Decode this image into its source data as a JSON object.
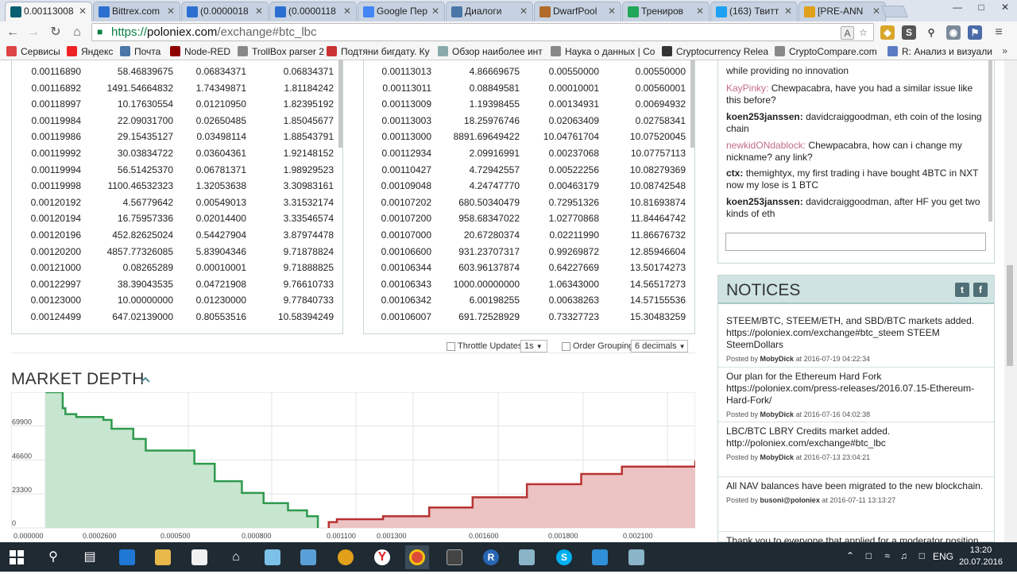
{
  "browser": {
    "tabs": [
      {
        "label": "0.00113008",
        "icon": "poloniex-icon",
        "color": "#0b5f73"
      },
      {
        "label": "Bittrex.com",
        "icon": "bittrex-icon",
        "color": "#2c6fd1"
      },
      {
        "label": "(0.0000018",
        "icon": "bittrex-icon",
        "color": "#2c6fd1"
      },
      {
        "label": "(0.0000118",
        "icon": "bittrex-icon",
        "color": "#2c6fd1"
      },
      {
        "label": "Google Пер",
        "icon": "google-translate-icon",
        "color": "#4285f4"
      },
      {
        "label": "Диалоги",
        "icon": "vk-icon",
        "color": "#4a76a8"
      },
      {
        "label": "DwarfPool",
        "icon": "dwarfpool-icon",
        "color": "#b36b2b"
      },
      {
        "label": "Трениров",
        "icon": "tradingview-icon",
        "color": "#22a65a"
      },
      {
        "label": "(163) Твитт",
        "icon": "twitter-icon",
        "color": "#1da1f2"
      },
      {
        "label": "[PRE-ANN",
        "icon": "bitcointalk-icon",
        "color": "#e0a019"
      }
    ],
    "url": {
      "scheme": "https://",
      "domain": "poloniex.com",
      "path": "/exchange#btc_lbc"
    },
    "bookmarks": [
      {
        "label": "Сервисы",
        "color": "#d44"
      },
      {
        "label": "Яндекс",
        "color": "#e22"
      },
      {
        "label": "Почта",
        "color": "#4a76a8"
      },
      {
        "label": "Node-RED",
        "color": "#8f0000"
      },
      {
        "label": "TrollBox parser 2",
        "color": "#888"
      },
      {
        "label": "Подтяни бигдату. Ку",
        "color": "#c33"
      },
      {
        "label": "Обзор наиболее инт",
        "color": "#8aa"
      },
      {
        "label": "Наука о данных | Co",
        "color": "#888"
      },
      {
        "label": "Cryptocurrency Relea",
        "color": "#333"
      },
      {
        "label": "CryptoCompare.com",
        "color": "#888"
      },
      {
        "label": "R: Анализ и визуали",
        "color": "#5b7cc4"
      }
    ]
  },
  "orderbook": {
    "sell_rows": [
      [
        "0.00116890",
        "58.46839675",
        "0.06834371",
        "0.06834371"
      ],
      [
        "0.00116892",
        "1491.54664832",
        "1.74349871",
        "1.81184242"
      ],
      [
        "0.00118997",
        "10.17630554",
        "0.01210950",
        "1.82395192"
      ],
      [
        "0.00119984",
        "22.09031700",
        "0.02650485",
        "1.85045677"
      ],
      [
        "0.00119986",
        "29.15435127",
        "0.03498114",
        "1.88543791"
      ],
      [
        "0.00119992",
        "30.03834722",
        "0.03604361",
        "1.92148152"
      ],
      [
        "0.00119994",
        "56.51425370",
        "0.06781371",
        "1.98929523"
      ],
      [
        "0.00119998",
        "1100.46532323",
        "1.32053638",
        "3.30983161"
      ],
      [
        "0.00120192",
        "4.56779642",
        "0.00549013",
        "3.31532174"
      ],
      [
        "0.00120194",
        "16.75957336",
        "0.02014400",
        "3.33546574"
      ],
      [
        "0.00120196",
        "452.82625024",
        "0.54427904",
        "3.87974478"
      ],
      [
        "0.00120200",
        "4857.77326085",
        "5.83904346",
        "9.71878824"
      ],
      [
        "0.00121000",
        "0.08265289",
        "0.00010001",
        "9.71888825"
      ],
      [
        "0.00122997",
        "38.39043535",
        "0.04721908",
        "9.76610733"
      ],
      [
        "0.00123000",
        "10.00000000",
        "0.01230000",
        "9.77840733"
      ],
      [
        "0.00124499",
        "647.02139000",
        "0.80553516",
        "10.58394249"
      ]
    ],
    "buy_rows": [
      [
        "0.00113013",
        "4.86669675",
        "0.00550000",
        "0.00550000"
      ],
      [
        "0.00113011",
        "0.08849581",
        "0.00010001",
        "0.00560001"
      ],
      [
        "0.00113009",
        "1.19398455",
        "0.00134931",
        "0.00694932"
      ],
      [
        "0.00113003",
        "18.25976746",
        "0.02063409",
        "0.02758341"
      ],
      [
        "0.00113000",
        "8891.69649422",
        "10.04761704",
        "10.07520045"
      ],
      [
        "0.00112934",
        "2.09916991",
        "0.00237068",
        "10.07757113"
      ],
      [
        "0.00110427",
        "4.72942557",
        "0.00522256",
        "10.08279369"
      ],
      [
        "0.00109048",
        "4.24747770",
        "0.00463179",
        "10.08742548"
      ],
      [
        "0.00107202",
        "680.50340479",
        "0.72951326",
        "10.81693874"
      ],
      [
        "0.00107200",
        "958.68347022",
        "1.02770868",
        "11.84464742"
      ],
      [
        "0.00107000",
        "20.67280374",
        "0.02211990",
        "11.86676732"
      ],
      [
        "0.00106600",
        "931.23707317",
        "0.99269872",
        "12.85946604"
      ],
      [
        "0.00106344",
        "603.96137874",
        "0.64227669",
        "13.50174273"
      ],
      [
        "0.00106343",
        "1000.00000000",
        "1.06343000",
        "14.56517273"
      ],
      [
        "0.00106342",
        "6.00198255",
        "0.00638263",
        "14.57155536"
      ],
      [
        "0.00106007",
        "691.72528929",
        "0.73327723",
        "15.30483259"
      ]
    ],
    "throttle_label": "Throttle Updates",
    "throttle_value": "1s",
    "grouping_label": "Order Grouping",
    "grouping_value": "6 decimals"
  },
  "market_depth": {
    "title": "MARKET DEPTH"
  },
  "chart_data": {
    "type": "area",
    "title": "MARKET DEPTH",
    "y_ticks": [
      "0",
      "23300",
      "46600",
      "69900"
    ],
    "x_ticks": [
      "0.000000",
      "0.0002600",
      "0.000500",
      "0.000800",
      "0.001100",
      "0.001300",
      "0.001600",
      "0.001800",
      "0.002100"
    ],
    "ylim": [
      0,
      93000
    ],
    "xlim": [
      0,
      0.00252
    ],
    "series": [
      {
        "side": "bid",
        "color": "#2f9a4f",
        "fill": "#c7e6cf",
        "x": [
          0.000127,
          0.00019,
          0.0002,
          0.00024,
          0.00034,
          0.00037,
          0.00045,
          0.000496,
          0.000675,
          0.00075,
          0.00085,
          0.00093,
          0.00102,
          0.00109,
          0.00113
        ],
        "y": [
          93000,
          82000,
          78000,
          76000,
          74000,
          68000,
          61000,
          53000,
          44000,
          32000,
          24000,
          17000,
          12000,
          8000,
          0
        ]
      },
      {
        "side": "ask",
        "color": "#b83232",
        "fill": "#ecc3c3",
        "x": [
          0.00117,
          0.0012,
          0.00137,
          0.00154,
          0.0017,
          0.0019,
          0.0021,
          0.00225,
          0.00252
        ],
        "y": [
          4000,
          6000,
          8000,
          14000,
          21000,
          30000,
          37000,
          42000,
          46000
        ]
      }
    ]
  },
  "chat": {
    "messages": [
      {
        "user": "",
        "text": "while providing no innovation",
        "pink": false
      },
      {
        "user": "KayPinky:",
        "text": "Chewpacabra, have you had a similar issue like this before?",
        "pink": true
      },
      {
        "user": "koen253janssen:",
        "text": "davidcraiggoodman, eth coin of the losing chain",
        "pink": false
      },
      {
        "user": "newkidONdablock:",
        "text": "Chewpacabra, how can i change my nickname? any link?",
        "pink": true
      },
      {
        "user": "ctx:",
        "text": "themightyx, my first trading i have bought 4BTC in NXT now my lose is 1 BTC",
        "pink": false
      },
      {
        "user": "koen253janssen:",
        "text": "davidcraiggoodman, after HF you get two kinds of eth",
        "pink": false
      }
    ],
    "input_value": ""
  },
  "notices": {
    "title": "NOTICES",
    "items": [
      {
        "text": "STEEM/BTC, STEEM/ETH, and SBD/BTC markets added. https://poloniex.com/exchange#btc_steem STEEM SteemDollars",
        "posted_by": "Posted by",
        "author": "MobyDick",
        "date": "at 2016-07-19 04:22:34"
      },
      {
        "text": "Our plan for the Ethereum Hard Fork https://poloniex.com/press-releases/2016.07.15-Ethereum-Hard-Fork/",
        "posted_by": "Posted by",
        "author": "MobyDick",
        "date": "at 2016-07-16 04:02:38"
      },
      {
        "text": "LBC/BTC LBRY Credits market added. http://poloniex.com/exchange#btc_lbc",
        "posted_by": "Posted by",
        "author": "MobyDick",
        "date": "at 2016-07-13 23:04:21"
      },
      {
        "text": "All NAV balances have been migrated to the new blockchain.",
        "posted_by": "Posted by",
        "author": "busoni@poloniex",
        "date": "at 2016-07-11 13:13:27"
      },
      {
        "text": "Thank you to everyone that applied for a moderator position at",
        "posted_by": "",
        "author": "",
        "date": ""
      }
    ]
  },
  "taskbar": {
    "lang": "ENG",
    "time": "13:20",
    "date": "20.07.2016"
  }
}
